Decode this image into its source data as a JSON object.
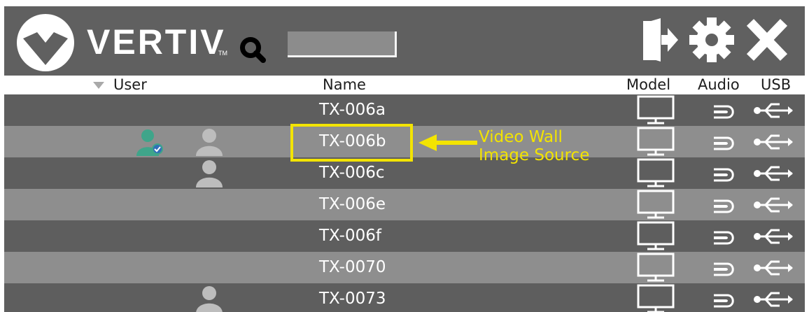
{
  "app": {
    "brand": "VERTIV",
    "brand_tm": "TM"
  },
  "search": {
    "value": "",
    "placeholder": ""
  },
  "toolbar": {
    "icons": [
      "logout-icon",
      "gear-icon",
      "close-icon"
    ]
  },
  "columns": {
    "user": "User",
    "name": "Name",
    "model": "Model",
    "audio": "Audio",
    "usb": "USB"
  },
  "rows": [
    {
      "name": "TX-006a",
      "users": []
    },
    {
      "name": "TX-006b",
      "users": [
        "current-user-icon",
        "user-icon"
      ]
    },
    {
      "name": "TX-006c",
      "users": [
        "user-icon"
      ]
    },
    {
      "name": "TX-006e",
      "users": []
    },
    {
      "name": "TX-006f",
      "users": []
    },
    {
      "name": "TX-0070",
      "users": []
    },
    {
      "name": "TX-0073",
      "users": [
        "user-icon"
      ]
    }
  ],
  "annotation": {
    "line1": "Video Wall",
    "line2": "Image Source"
  },
  "colors": {
    "topbar": "#606060",
    "row_dark": "#5e5e5e",
    "row_light": "#8e8e8e",
    "highlight": "#f3e400",
    "connected_user": "#3fa58a"
  }
}
